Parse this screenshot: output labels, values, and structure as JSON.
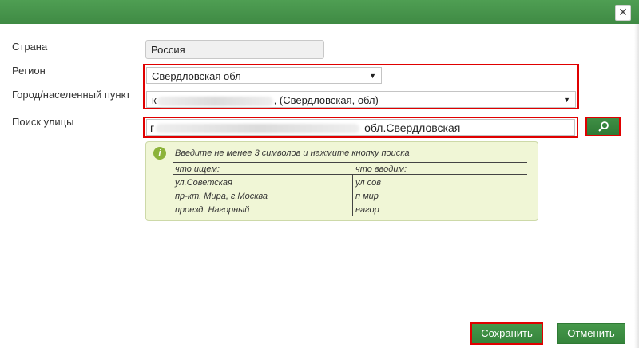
{
  "dialog": {
    "close_icon": "close-icon"
  },
  "form": {
    "country": {
      "label": "Страна",
      "value": "Россия"
    },
    "region": {
      "label": "Регион",
      "value": "Свердловская обл"
    },
    "city": {
      "label": "Город/населенный пункт",
      "prefix": "к",
      "value_suffix": ", (Свердловская, обл)"
    },
    "street": {
      "label": "Поиск улицы",
      "prefix": "г",
      "value_suffix": "обл.Свердловская"
    }
  },
  "hint": {
    "icon": "info-icon",
    "title": "Введите не менее 3 символов и нажмите кнопку поиска",
    "col_left": "что ищем:",
    "col_right": "что вводим:",
    "rows": [
      {
        "search": "ул.Советская",
        "input": "ул сов"
      },
      {
        "search": "пр-кт. Мира, г.Москва",
        "input": "п мир"
      },
      {
        "search": "проезд. Нагорный",
        "input": "нагор"
      }
    ]
  },
  "buttons": {
    "save": "Сохранить",
    "cancel": "Отменить",
    "search_icon": "search-icon"
  },
  "colors": {
    "header_green": "#3f8a44",
    "highlight_red": "#e00000",
    "hint_bg": "#f0f6d6"
  }
}
